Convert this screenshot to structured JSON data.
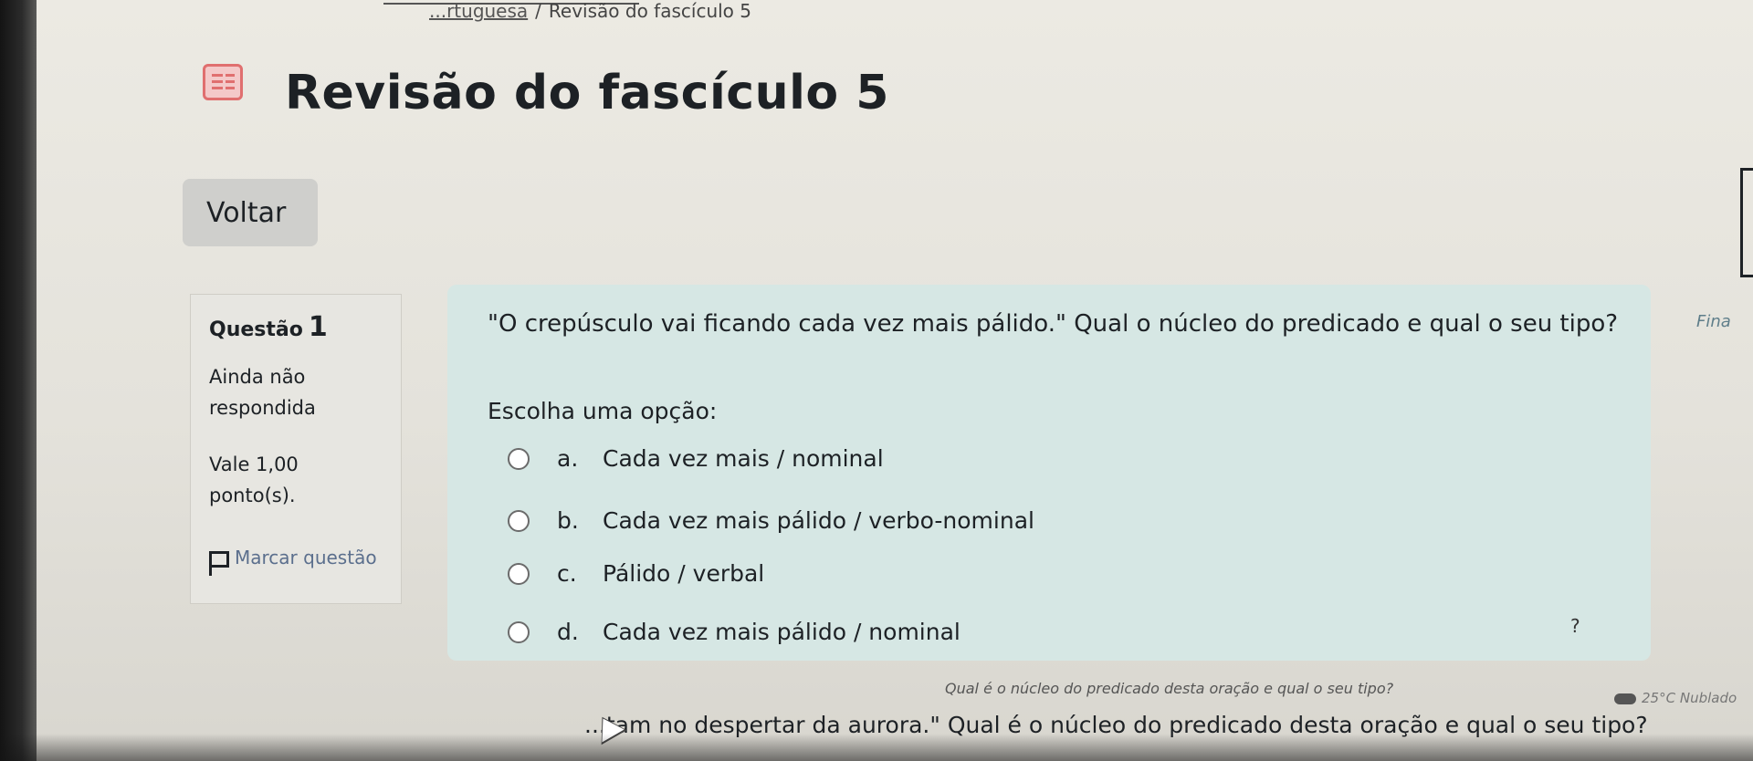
{
  "breadcrumb": {
    "previous": "...rtuguesa",
    "current": "Revisão do fascículo 5"
  },
  "page": {
    "title": "Revisão do fascículo 5",
    "back_label": "Voltar"
  },
  "question_info": {
    "label": "Questão",
    "number": "1",
    "status": "Ainda não respondida",
    "grade": "Vale 1,00 ponto(s).",
    "flag_label": "Marcar questão"
  },
  "question": {
    "text": "\"O crepúsculo vai ficando cada vez mais pálido.\" Qual o núcleo do predicado e qual o seu tipo?",
    "prompt": "Escolha uma opção:",
    "options": [
      {
        "letter": "a.",
        "text": "Cada vez mais / nominal",
        "selected": false
      },
      {
        "letter": "b.",
        "text": "Cada vez mais pálido / verbo-nominal",
        "selected": false
      },
      {
        "letter": "c.",
        "text": "Pálido / verbal",
        "selected": false
      },
      {
        "letter": "d.",
        "text": "Cada vez mais pálido / nominal",
        "selected": false
      }
    ]
  },
  "right_edge_label": "Fina",
  "help_label": "?",
  "next_question_text": "...tam no despertar da aurora.\" Qual é o núcleo do predicado desta oração e qual o seu tipo?",
  "tooltip_text": "Qual é o núcleo do predicado desta oração e qual o seu tipo?",
  "weather": {
    "temperature": "25°C",
    "condition": "Nublado"
  },
  "colors": {
    "question_bg": "#d6e7e4",
    "info_bg": "#e7e6e1",
    "flag_text": "#5b6f8d",
    "title_icon": "#e06f6f"
  }
}
